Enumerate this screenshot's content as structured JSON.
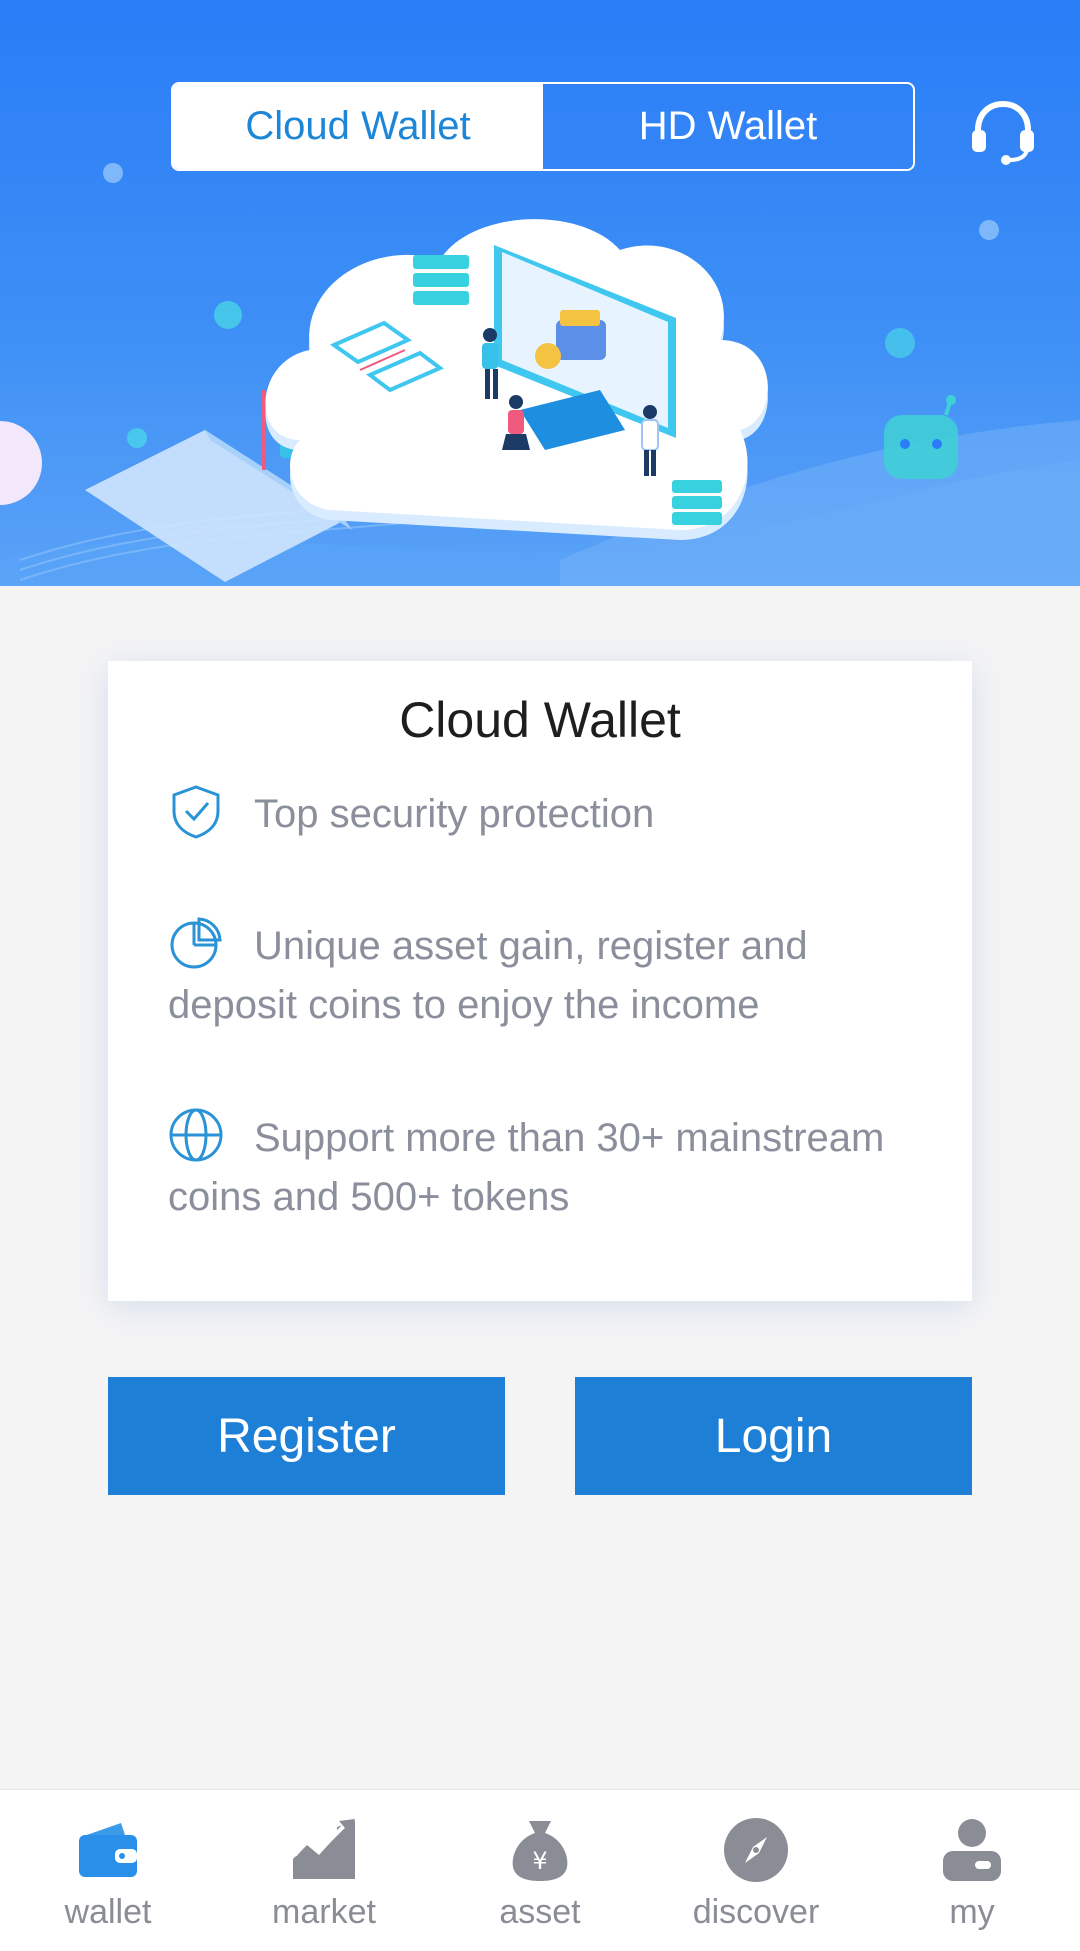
{
  "header": {
    "tabs": [
      {
        "label": "Cloud Wallet",
        "active": true
      },
      {
        "label": "HD Wallet",
        "active": false
      }
    ],
    "support_icon": "headset-icon"
  },
  "card": {
    "title": "Cloud Wallet",
    "features": [
      {
        "icon": "shield-check-icon",
        "text": "Top security protection"
      },
      {
        "icon": "pie-chart-icon",
        "text": "Unique asset gain, register and deposit coins to enjoy the income"
      },
      {
        "icon": "globe-icon",
        "text": "Support more than 30+ mainstream coins and 500+ tokens"
      }
    ]
  },
  "actions": {
    "register_label": "Register",
    "login_label": "Login"
  },
  "tabbar": {
    "items": [
      {
        "label": "wallet",
        "icon": "wallet-icon",
        "active": true
      },
      {
        "label": "market",
        "icon": "chart-trend-icon",
        "active": false
      },
      {
        "label": "asset",
        "icon": "money-bag-icon",
        "active": false
      },
      {
        "label": "discover",
        "icon": "compass-icon",
        "active": false
      },
      {
        "label": "my",
        "icon": "user-icon",
        "active": false
      }
    ]
  },
  "colors": {
    "primary": "#1e7fd6",
    "hero_blue": "#2a7cf7",
    "tab_active": "#2a8fe8",
    "tab_inactive": "#8a8d96",
    "feature_text": "#8b8f9c"
  }
}
